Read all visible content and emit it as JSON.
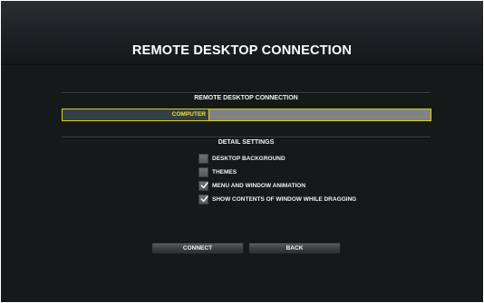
{
  "window": {
    "title": "REMOTE DESKTOP CONNECTION"
  },
  "connection_section": {
    "heading": "REMOTE DESKTOP CONNECTION",
    "computer_field": {
      "label": "COMPUTER",
      "value": "",
      "placeholder": ""
    }
  },
  "detail_settings": {
    "heading": "DETAIL SETTINGS",
    "options": [
      {
        "label": "DESKTOP BACKGROUND",
        "checked": false
      },
      {
        "label": "THEMES",
        "checked": false
      },
      {
        "label": "MENU AND WINDOW ANIMATION",
        "checked": true
      },
      {
        "label": "SHOW CONTENTS OF WINDOW WHILE DRAGGING",
        "checked": true
      }
    ]
  },
  "buttons": {
    "connect_label": "CONNECT",
    "back_label": "BACK"
  },
  "colors": {
    "accent_yellow": "#f1e52a",
    "field_border": "#d8d11a",
    "background": "#15191a",
    "checkbox_fill": "#5f6367"
  },
  "icons": {
    "check": "check-icon"
  }
}
